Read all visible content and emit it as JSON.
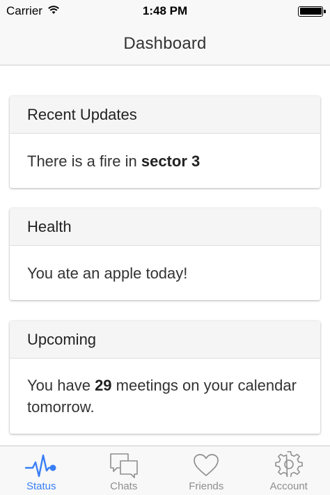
{
  "status_bar": {
    "carrier": "Carrier",
    "time": "1:48 PM"
  },
  "nav": {
    "title": "Dashboard"
  },
  "cards": [
    {
      "header": "Recent Updates",
      "body_text": "There is a fire in ",
      "body_bold": "sector 3"
    },
    {
      "header": "Health",
      "body_text": "You ate an apple today!"
    },
    {
      "header": "Upcoming",
      "body_pre": "You have ",
      "body_bold": "29",
      "body_post": " meetings on your calendar tomorrow."
    }
  ],
  "tabs": [
    {
      "label": "Status",
      "icon": "pulse-icon",
      "active": true
    },
    {
      "label": "Chats",
      "icon": "chat-bubbles-icon",
      "active": false
    },
    {
      "label": "Friends",
      "icon": "heart-icon",
      "active": false
    },
    {
      "label": "Account",
      "icon": "gear-icon",
      "active": false
    }
  ],
  "colors": {
    "accent": "#387ef5",
    "inactive_tab": "#8e8e8e",
    "card_header_bg": "#f5f5f5"
  }
}
